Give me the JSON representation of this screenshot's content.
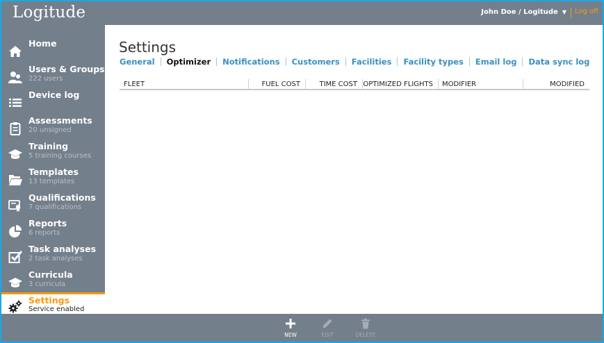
{
  "app": {
    "logo": "Logitude"
  },
  "header": {
    "user": "John Doe / Logitude",
    "logoff": "Log off"
  },
  "sidebar": {
    "items": [
      {
        "title": "Home",
        "subtitle": "",
        "icon": "home-icon"
      },
      {
        "title": "Users & Groups",
        "subtitle": "222 users",
        "icon": "users-icon"
      },
      {
        "title": "Device log",
        "subtitle": "",
        "icon": "list-icon"
      },
      {
        "title": "Assessments",
        "subtitle": "20 unsigned",
        "icon": "clipboard-icon"
      },
      {
        "title": "Training",
        "subtitle": "5 training courses",
        "icon": "graduation-cap-icon"
      },
      {
        "title": "Templates",
        "subtitle": "13 templates",
        "icon": "folder-icon"
      },
      {
        "title": "Qualifications",
        "subtitle": "7 qualifications",
        "icon": "certificate-icon"
      },
      {
        "title": "Reports",
        "subtitle": "6 reports",
        "icon": "pie-chart-icon"
      },
      {
        "title": "Task analyses",
        "subtitle": "2 task analyses",
        "icon": "checkbox-icon"
      },
      {
        "title": "Curricula",
        "subtitle": "3 curricula",
        "icon": "graduation-cap-icon"
      },
      {
        "title": "Settings",
        "subtitle": "Service enabled",
        "icon": "gears-icon"
      }
    ]
  },
  "main": {
    "title": "Settings",
    "tabs": [
      "General",
      "Optimizer",
      "Notifications",
      "Customers",
      "Facilities",
      "Facility types",
      "Email log",
      "Data sync log"
    ],
    "active_tab": "Optimizer",
    "columns": [
      "FLEET",
      "FUEL COST",
      "TIME COST",
      "OPTIMIZED FLIGHTS",
      "MODIFIER",
      "MODIFIED"
    ]
  },
  "toolbar": {
    "new_label": "NEW",
    "edit_label": "EDIT",
    "delete_label": "DELETE"
  },
  "colors": {
    "chrome": "#747f8c",
    "accent": "#f39c12",
    "link": "#3a8fc2",
    "border": "#1aa8e6"
  }
}
